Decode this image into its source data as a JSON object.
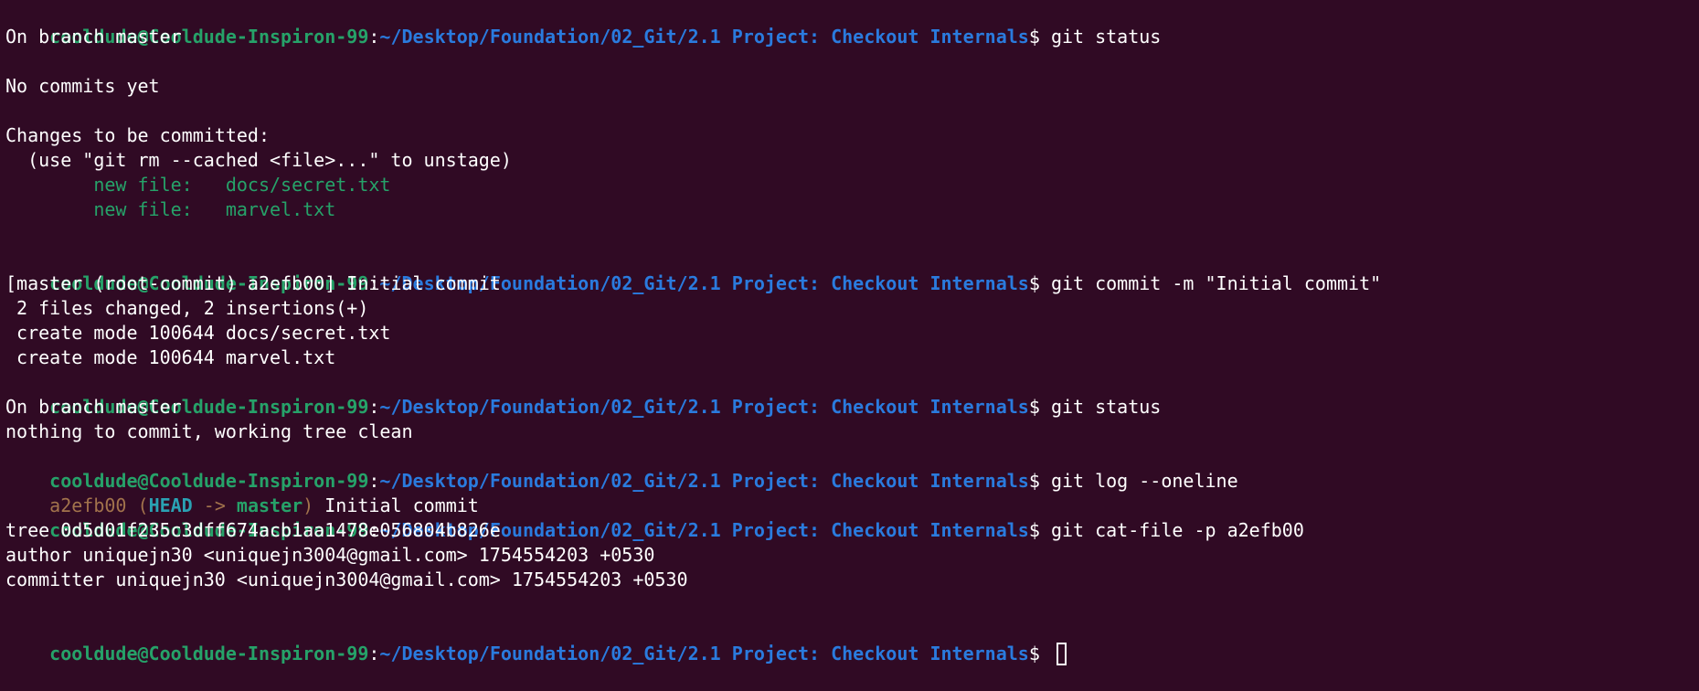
{
  "terminal": {
    "prompt": {
      "user": "cooldude@Cooldude-Inspiron-99",
      "sep": ":",
      "path": "~/Desktop/Foundation/02_Git/2.1 Project: Checkout Internals",
      "symbol": "$ "
    },
    "commands": {
      "status1": "git status",
      "commit": "git commit -m \"Initial commit\"",
      "status2": "git status",
      "log": "git log --oneline",
      "catfile": "git cat-file -p a2efb00"
    },
    "status1": {
      "branch": "On branch master",
      "no_commits": "No commits yet",
      "changes_header": "Changes to be committed:",
      "hint": "  (use \"git rm --cached <file>...\" to unstage)",
      "files": [
        "        new file:   docs/secret.txt",
        "        new file:   marvel.txt"
      ]
    },
    "commit_output": [
      "[master (root-commit) a2efb00] Initial commit",
      " 2 files changed, 2 insertions(+)",
      " create mode 100644 docs/secret.txt",
      " create mode 100644 marvel.txt"
    ],
    "status2": {
      "branch": "On branch master",
      "clean": "nothing to commit, working tree clean"
    },
    "log": {
      "hash": "a2efb00",
      "open": " (",
      "head": "HEAD",
      "arrow": " -> ",
      "branch": "master",
      "close": ")",
      "message": " Initial commit"
    },
    "catfile": [
      "tree 0d5d01f235c3dff674acb1aa1478e056804b826e",
      "author uniquejn30 <uniquejn3004@gmail.com> 1754554203 +0530",
      "committer uniquejn30 <uniquejn3004@gmail.com> 1754554203 +0530"
    ]
  },
  "colors": {
    "background": "#300a24",
    "prompt_user": "#26a269",
    "prompt_path": "#2a7bde",
    "staged_file": "#26a269",
    "commit_hash": "#a2734c",
    "head_ref": "#2aa1b3"
  }
}
